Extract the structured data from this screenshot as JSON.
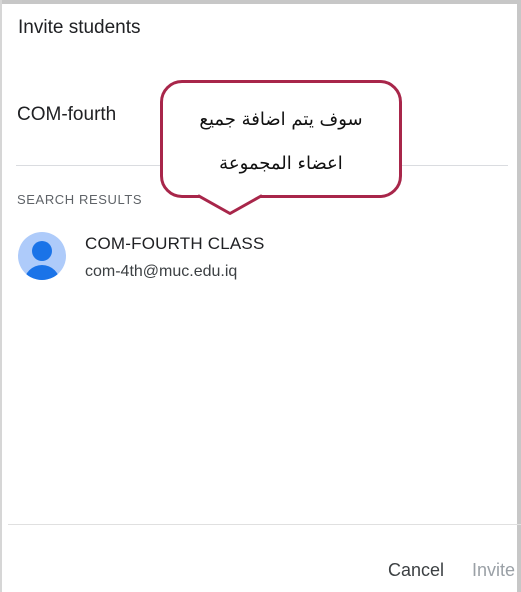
{
  "dialog": {
    "title": "Invite students",
    "search_value": "COM-fourth",
    "results_header": "SEARCH RESULTS"
  },
  "results": [
    {
      "name": "COM-FOURTH CLASS",
      "email": "com-4th@muc.edu.iq",
      "avatar_icon": "person-icon"
    }
  ],
  "footer": {
    "cancel_label": "Cancel",
    "invite_label": "Invite"
  },
  "callout": {
    "line1": "سوف يتم اضافة جميع",
    "line2": "اعضاء المجموعة",
    "border_color": "#a8264a"
  },
  "colors": {
    "accent": "#1a73e8",
    "avatar_bg": "#aecbfa",
    "disabled_text": "#9aa0a6"
  }
}
